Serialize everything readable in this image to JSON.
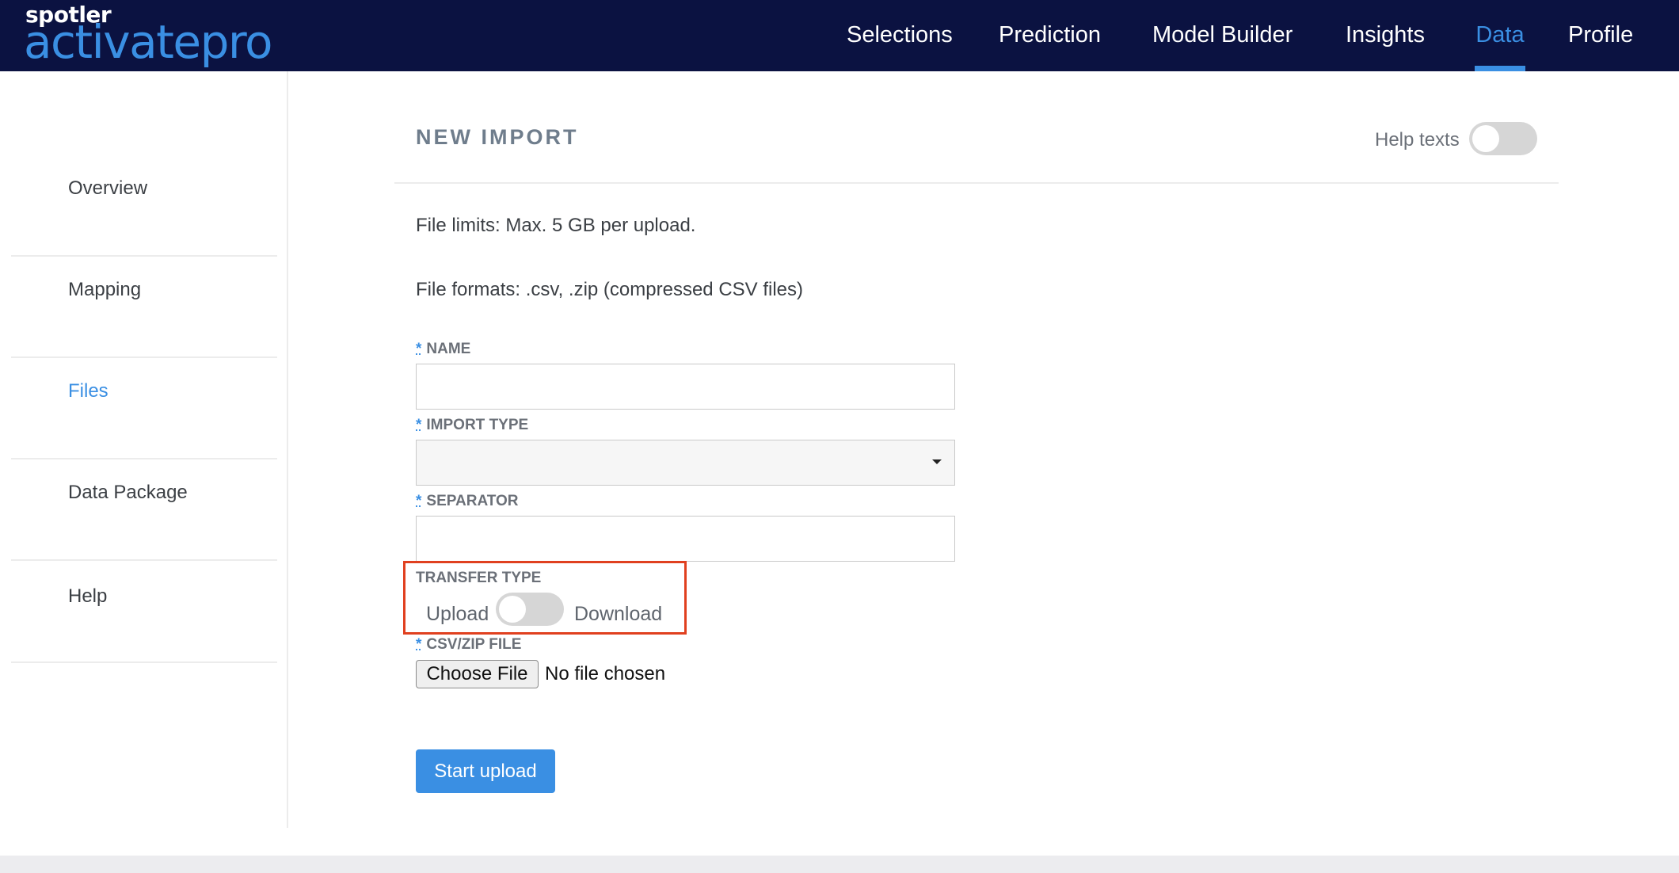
{
  "brand": {
    "small": "spotler",
    "big": "activatepro"
  },
  "nav": {
    "items": [
      {
        "label": "Selections"
      },
      {
        "label": "Prediction"
      },
      {
        "label": "Model Builder"
      },
      {
        "label": "Insights"
      },
      {
        "label": "Data",
        "active": true
      },
      {
        "label": "Profile"
      }
    ]
  },
  "sidebar": {
    "items": [
      {
        "label": "Overview"
      },
      {
        "label": "Mapping"
      },
      {
        "label": "Files",
        "active": true
      },
      {
        "label": "Data Package"
      },
      {
        "label": "Help"
      }
    ]
  },
  "page": {
    "title": "NEW IMPORT",
    "help_label": "Help texts",
    "help_enabled": false,
    "file_limits": "File limits: Max. 5 GB per upload.",
    "file_formats": "File formats: .csv, .zip (compressed CSV files)"
  },
  "form": {
    "required_mark": "*",
    "name_label": "NAME",
    "name_value": "",
    "import_type_label": "IMPORT TYPE",
    "import_type_value": "",
    "separator_label": "SEPARATOR",
    "separator_value": "",
    "transfer_type_label": "TRANSFER TYPE",
    "transfer_left": "Upload",
    "transfer_right": "Download",
    "transfer_is_download": false,
    "file_label": "CSV/ZIP FILE",
    "choose_file_label": "Choose File",
    "file_status": "No file chosen",
    "submit_label": "Start upload"
  },
  "colors": {
    "header_bg": "#0b1241",
    "accent": "#3a8fe3",
    "highlight": "#e0401f"
  }
}
